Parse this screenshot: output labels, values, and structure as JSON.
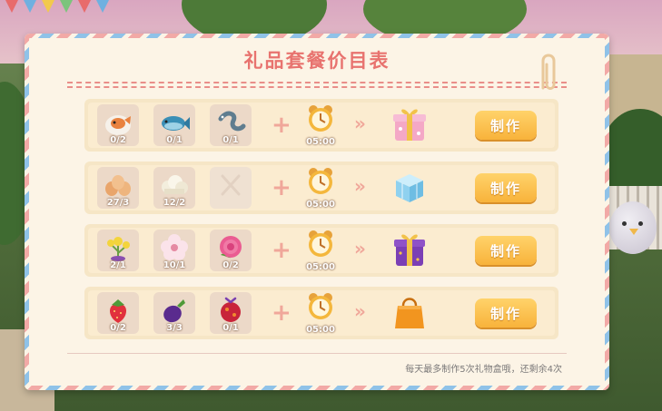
{
  "panel": {
    "title": "礼品套餐价目表",
    "note": "每天最多制作5次礼物盒哦，还剩余4次"
  },
  "rows": [
    {
      "ingredients": [
        {
          "icon": "fish-bowl-icon",
          "count": "0/2"
        },
        {
          "icon": "blue-fish-icon",
          "count": "0/1"
        },
        {
          "icon": "eel-icon",
          "count": "0/1"
        }
      ],
      "time": "05:00",
      "result_icon": "pink-gift-box-icon",
      "button_label": "制作"
    },
    {
      "ingredients": [
        {
          "icon": "eggs-icon",
          "count": "27/3"
        },
        {
          "icon": "cotton-icon",
          "count": "12/2"
        },
        {
          "icon": "empty-slot-icon",
          "count": ""
        }
      ],
      "time": "05:00",
      "result_icon": "blue-cube-gift-icon",
      "button_label": "制作"
    },
    {
      "ingredients": [
        {
          "icon": "yellow-flower-icon",
          "count": "2/1"
        },
        {
          "icon": "white-flower-icon",
          "count": "10/1"
        },
        {
          "icon": "pink-rose-icon",
          "count": "0/2"
        }
      ],
      "time": "05:00",
      "result_icon": "purple-gift-box-icon",
      "button_label": "制作"
    },
    {
      "ingredients": [
        {
          "icon": "strawberry-icon",
          "count": "0/2"
        },
        {
          "icon": "eggplant-icon",
          "count": "3/3"
        },
        {
          "icon": "red-berry-icon",
          "count": "0/1"
        }
      ],
      "time": "05:00",
      "result_icon": "orange-gift-bag-icon",
      "button_label": "制作"
    }
  ],
  "colors": {
    "title": "#e8736f",
    "button": "#f8b33b",
    "card": "#fcf4e6"
  }
}
